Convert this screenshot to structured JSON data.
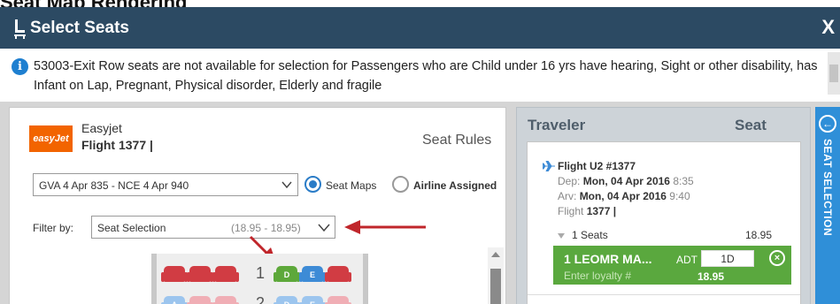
{
  "page": {
    "top_heading": "Seat Map Rendering"
  },
  "dialog": {
    "title": "Select Seats",
    "close_glyph": "X",
    "icon": "seat-icon"
  },
  "notice": {
    "icon": "info-icon",
    "info_glyph": "i",
    "text": "53003-Exit Row seats are not available for selection for Passengers who are Child under 16 yrs have hearing, Sight or other disability, has Infant on Lap, Pregnant, Physical disorder, Elderly and fragile"
  },
  "flight_panel": {
    "logo_text": "easyJet",
    "airline": "Easyjet",
    "flight": "Flight 1377 |",
    "seat_rules": "Seat Rules",
    "segment": "GVA 4 Apr 835 - NCE 4 Apr 940",
    "mode_seat_maps": "Seat Maps",
    "mode_airline_assigned": "Airline Assigned",
    "filter_label": "Filter by:",
    "filter_value": "Seat Selection",
    "filter_range": "(18.95 - 18.95)"
  },
  "seatmap": {
    "rows": [
      {
        "number": "1",
        "left": [
          {
            "label": "",
            "status": "red"
          },
          {
            "label": "",
            "status": "red"
          },
          {
            "label": "",
            "status": "red"
          }
        ],
        "right": [
          {
            "label": "D",
            "status": "green"
          },
          {
            "label": "E",
            "status": "blue"
          },
          {
            "label": "",
            "status": "red"
          }
        ]
      },
      {
        "number": "2",
        "left": [
          {
            "label": "A",
            "status": "lblue"
          },
          {
            "label": "",
            "status": "pink"
          },
          {
            "label": "",
            "status": "pink"
          }
        ],
        "right": [
          {
            "label": "D",
            "status": "lblue"
          },
          {
            "label": "E",
            "status": "lblue"
          },
          {
            "label": "",
            "status": "pink"
          }
        ]
      }
    ]
  },
  "traveler_panel": {
    "header_traveler": "Traveler",
    "header_seat": "Seat",
    "flight_line": "Flight U2 #1377",
    "dep_label": "Dep:",
    "dep_date": "Mon, 04 Apr 2016",
    "dep_time": "8:35",
    "arv_label": "Arv:",
    "arv_date": "Mon, 04 Apr 2016",
    "arv_time": "9:40",
    "flight_label": "Flight",
    "flight_num": "1377 |",
    "seats_count": "1 Seats",
    "seats_price": "18.95",
    "passenger": {
      "name": "1 LEOMR MA...",
      "type": "ADT",
      "seat": "1D",
      "remove_glyph": "×",
      "loyalty_placeholder": "Enter loyalty #",
      "price": "18.95"
    }
  },
  "side_tab": {
    "label": "SEAT SELECTION",
    "glyph": "←"
  },
  "colors": {
    "titlebar": "#2c4a63",
    "selected": "#5da83a",
    "available": "#3d8bd6",
    "occupied": "#d13c43",
    "accent": "#2f8fd8"
  }
}
